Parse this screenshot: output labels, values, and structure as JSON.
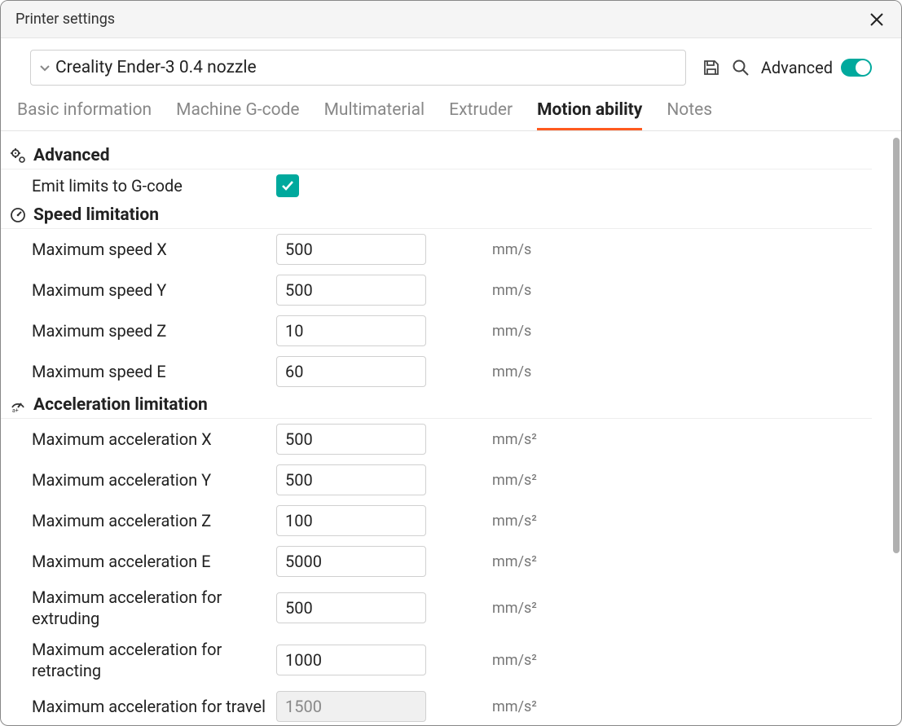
{
  "title": "Printer settings",
  "preset": "Creality Ender-3 0.4 nozzle",
  "advanced_label": "Advanced",
  "tabs": [
    {
      "label": "Basic information",
      "active": false
    },
    {
      "label": "Machine G-code",
      "active": false
    },
    {
      "label": "Multimaterial",
      "active": false
    },
    {
      "label": "Extruder",
      "active": false
    },
    {
      "label": "Motion ability",
      "active": true
    },
    {
      "label": "Notes",
      "active": false
    }
  ],
  "sections": {
    "advanced": {
      "title": "Advanced",
      "emit_limits_label": "Emit limits to G-code",
      "emit_limits_checked": true
    },
    "speed": {
      "title": "Speed limitation",
      "rows": [
        {
          "label": "Maximum speed X",
          "value": "500",
          "unit": "mm/s"
        },
        {
          "label": "Maximum speed Y",
          "value": "500",
          "unit": "mm/s"
        },
        {
          "label": "Maximum speed Z",
          "value": "10",
          "unit": "mm/s"
        },
        {
          "label": "Maximum speed E",
          "value": "60",
          "unit": "mm/s"
        }
      ]
    },
    "accel": {
      "title": "Acceleration limitation",
      "rows": [
        {
          "label": "Maximum acceleration X",
          "value": "500",
          "unit": "mm/s²",
          "disabled": false
        },
        {
          "label": "Maximum acceleration Y",
          "value": "500",
          "unit": "mm/s²",
          "disabled": false
        },
        {
          "label": "Maximum acceleration Z",
          "value": "100",
          "unit": "mm/s²",
          "disabled": false
        },
        {
          "label": "Maximum acceleration E",
          "value": "5000",
          "unit": "mm/s²",
          "disabled": false
        },
        {
          "label": "Maximum acceleration for extruding",
          "value": "500",
          "unit": "mm/s²",
          "disabled": false
        },
        {
          "label": "Maximum acceleration for retracting",
          "value": "1000",
          "unit": "mm/s²",
          "disabled": false
        },
        {
          "label": "Maximum acceleration for travel",
          "value": "1500",
          "unit": "mm/s²",
          "disabled": true
        }
      ]
    }
  }
}
